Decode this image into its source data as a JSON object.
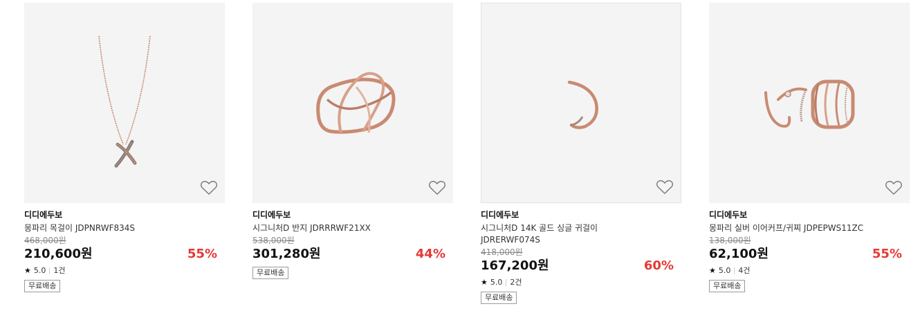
{
  "products": [
    {
      "brand": "디디에두보",
      "name": "몽파리 목걸이 JDPNRWF834S",
      "original_price": "468,000원",
      "price": "210,600원",
      "discount": "55%",
      "rating": "5.0",
      "review_count": "1건",
      "badge": "무료배송",
      "image_icon": "necklace-icon",
      "wishlist_icon": "heart-outline-icon"
    },
    {
      "brand": "디디에두보",
      "name": "시그니처D 반지 JDRRRWF21XX",
      "original_price": "538,000원",
      "price": "301,280원",
      "discount": "44%",
      "badge": "무료배송",
      "image_icon": "ring-icon",
      "wishlist_icon": "heart-outline-icon"
    },
    {
      "brand": "디디에두보",
      "name": "시그니처D 14K 골드 싱글 귀걸이 JDRERWF074S",
      "original_price": "418,000원",
      "price": "167,200원",
      "discount": "60%",
      "rating": "5.0",
      "review_count": "2건",
      "badge": "무료배송",
      "image_icon": "earring-icon",
      "wishlist_icon": "heart-outline-icon"
    },
    {
      "brand": "디디에두보",
      "name": "몽파리 실버 이어커프/귀찌 JDPEPWS11ZC",
      "original_price": "138,000원",
      "price": "62,100원",
      "discount": "55%",
      "rating": "5.0",
      "review_count": "4건",
      "badge": "무료배송",
      "image_icon": "ear-cuff-icon",
      "wishlist_icon": "heart-outline-icon"
    }
  ],
  "colors": {
    "discount": "#e53935",
    "thumb_bg": "#f4f4f4",
    "rose_gold": "#c98a72"
  }
}
